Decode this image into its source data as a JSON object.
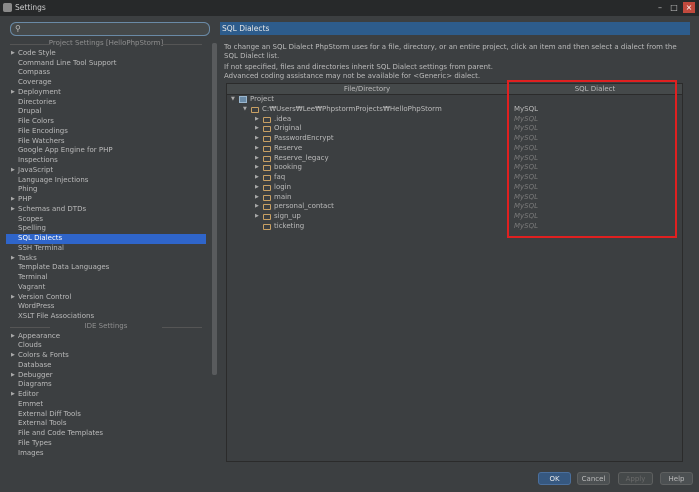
{
  "window": {
    "title": "Settings",
    "background_tabs": [
      "",
      "",
      "",
      "",
      "",
      "",
      ""
    ]
  },
  "sidebar": {
    "search_value": "",
    "items": [
      {
        "label": "Project Settings [HelloPhpStorm]",
        "type": "section"
      },
      {
        "label": "Code Style",
        "arrow": true
      },
      {
        "label": "Command Line Tool Support"
      },
      {
        "label": "Compass"
      },
      {
        "label": "Coverage"
      },
      {
        "label": "Deployment",
        "arrow": true
      },
      {
        "label": "Directories"
      },
      {
        "label": "Drupal"
      },
      {
        "label": "File Colors"
      },
      {
        "label": "File Encodings"
      },
      {
        "label": "File Watchers"
      },
      {
        "label": "Google App Engine for PHP"
      },
      {
        "label": "Inspections"
      },
      {
        "label": "JavaScript",
        "arrow": true
      },
      {
        "label": "Language Injections"
      },
      {
        "label": "Phing"
      },
      {
        "label": "PHP",
        "arrow": true
      },
      {
        "label": "Schemas and DTDs",
        "arrow": true
      },
      {
        "label": "Scopes"
      },
      {
        "label": "Spelling"
      },
      {
        "label": "SQL Dialects",
        "selected": true
      },
      {
        "label": "SSH Terminal"
      },
      {
        "label": "Tasks",
        "arrow": true
      },
      {
        "label": "Template Data Languages"
      },
      {
        "label": "Terminal"
      },
      {
        "label": "Vagrant"
      },
      {
        "label": "Version Control",
        "arrow": true
      },
      {
        "label": "WordPress"
      },
      {
        "label": "XSLT File Associations"
      },
      {
        "label": "IDE Settings",
        "type": "section"
      },
      {
        "label": "Appearance",
        "arrow": true
      },
      {
        "label": "Clouds"
      },
      {
        "label": "Colors & Fonts",
        "arrow": true
      },
      {
        "label": "Database"
      },
      {
        "label": "Debugger",
        "arrow": true
      },
      {
        "label": "Diagrams"
      },
      {
        "label": "Editor",
        "arrow": true
      },
      {
        "label": "Emmet"
      },
      {
        "label": "External Diff Tools"
      },
      {
        "label": "External Tools"
      },
      {
        "label": "File and Code Templates"
      },
      {
        "label": "File Types"
      },
      {
        "label": "Images"
      }
    ]
  },
  "main": {
    "title": "SQL Dialects",
    "description": "To change an SQL Dialect PhpStorm uses for a file, directory, or an entire project, click an item and then select a dialect from the SQL Dialect list.",
    "note_line1": "If not specified, files and directories inherit SQL Dialect settings from parent.",
    "note_line2": "Advanced coding assistance may not be available for <Generic> dialect.",
    "col_file": "File/Directory",
    "col_dialect": "SQL Dialect",
    "rows": [
      {
        "name": "Project",
        "level": 0,
        "kind": "project",
        "expanded": true,
        "dialect": ""
      },
      {
        "name": "C:₩Users₩Lee₩PhpstormProjects₩HelloPhpStorm",
        "level": 1,
        "kind": "folder",
        "expanded": true,
        "dialect": "MySQL",
        "inherited": false
      },
      {
        "name": ".idea",
        "level": 2,
        "kind": "folder",
        "dialect": "MySQL",
        "inherited": true
      },
      {
        "name": "Original",
        "level": 2,
        "kind": "folder",
        "dialect": "MySQL",
        "inherited": true
      },
      {
        "name": "PasswordEncrypt",
        "level": 2,
        "kind": "folder",
        "dialect": "MySQL",
        "inherited": true
      },
      {
        "name": "Reserve",
        "level": 2,
        "kind": "folder",
        "dialect": "MySQL",
        "inherited": true
      },
      {
        "name": "Reserve_legacy",
        "level": 2,
        "kind": "folder",
        "dialect": "MySQL",
        "inherited": true
      },
      {
        "name": "booking",
        "level": 2,
        "kind": "folder",
        "dialect": "MySQL",
        "inherited": true
      },
      {
        "name": "faq",
        "level": 2,
        "kind": "folder",
        "dialect": "MySQL",
        "inherited": true
      },
      {
        "name": "login",
        "level": 2,
        "kind": "folder",
        "dialect": "MySQL",
        "inherited": true
      },
      {
        "name": "main",
        "level": 2,
        "kind": "folder",
        "dialect": "MySQL",
        "inherited": true
      },
      {
        "name": "personal_contact",
        "level": 2,
        "kind": "folder",
        "dialect": "MySQL",
        "inherited": true
      },
      {
        "name": "sign_up",
        "level": 2,
        "kind": "folder",
        "dialect": "MySQL",
        "inherited": true
      },
      {
        "name": "ticketing",
        "level": 2,
        "kind": "folder",
        "leaf": true,
        "dialect": "MySQL",
        "inherited": true
      }
    ]
  },
  "footer": {
    "ok": "OK",
    "cancel": "Cancel",
    "apply": "Apply",
    "help": "Help"
  },
  "colors": {
    "selection": "#2f65ca",
    "header": "#2d5c8c",
    "highlight_box": "#e02020"
  }
}
